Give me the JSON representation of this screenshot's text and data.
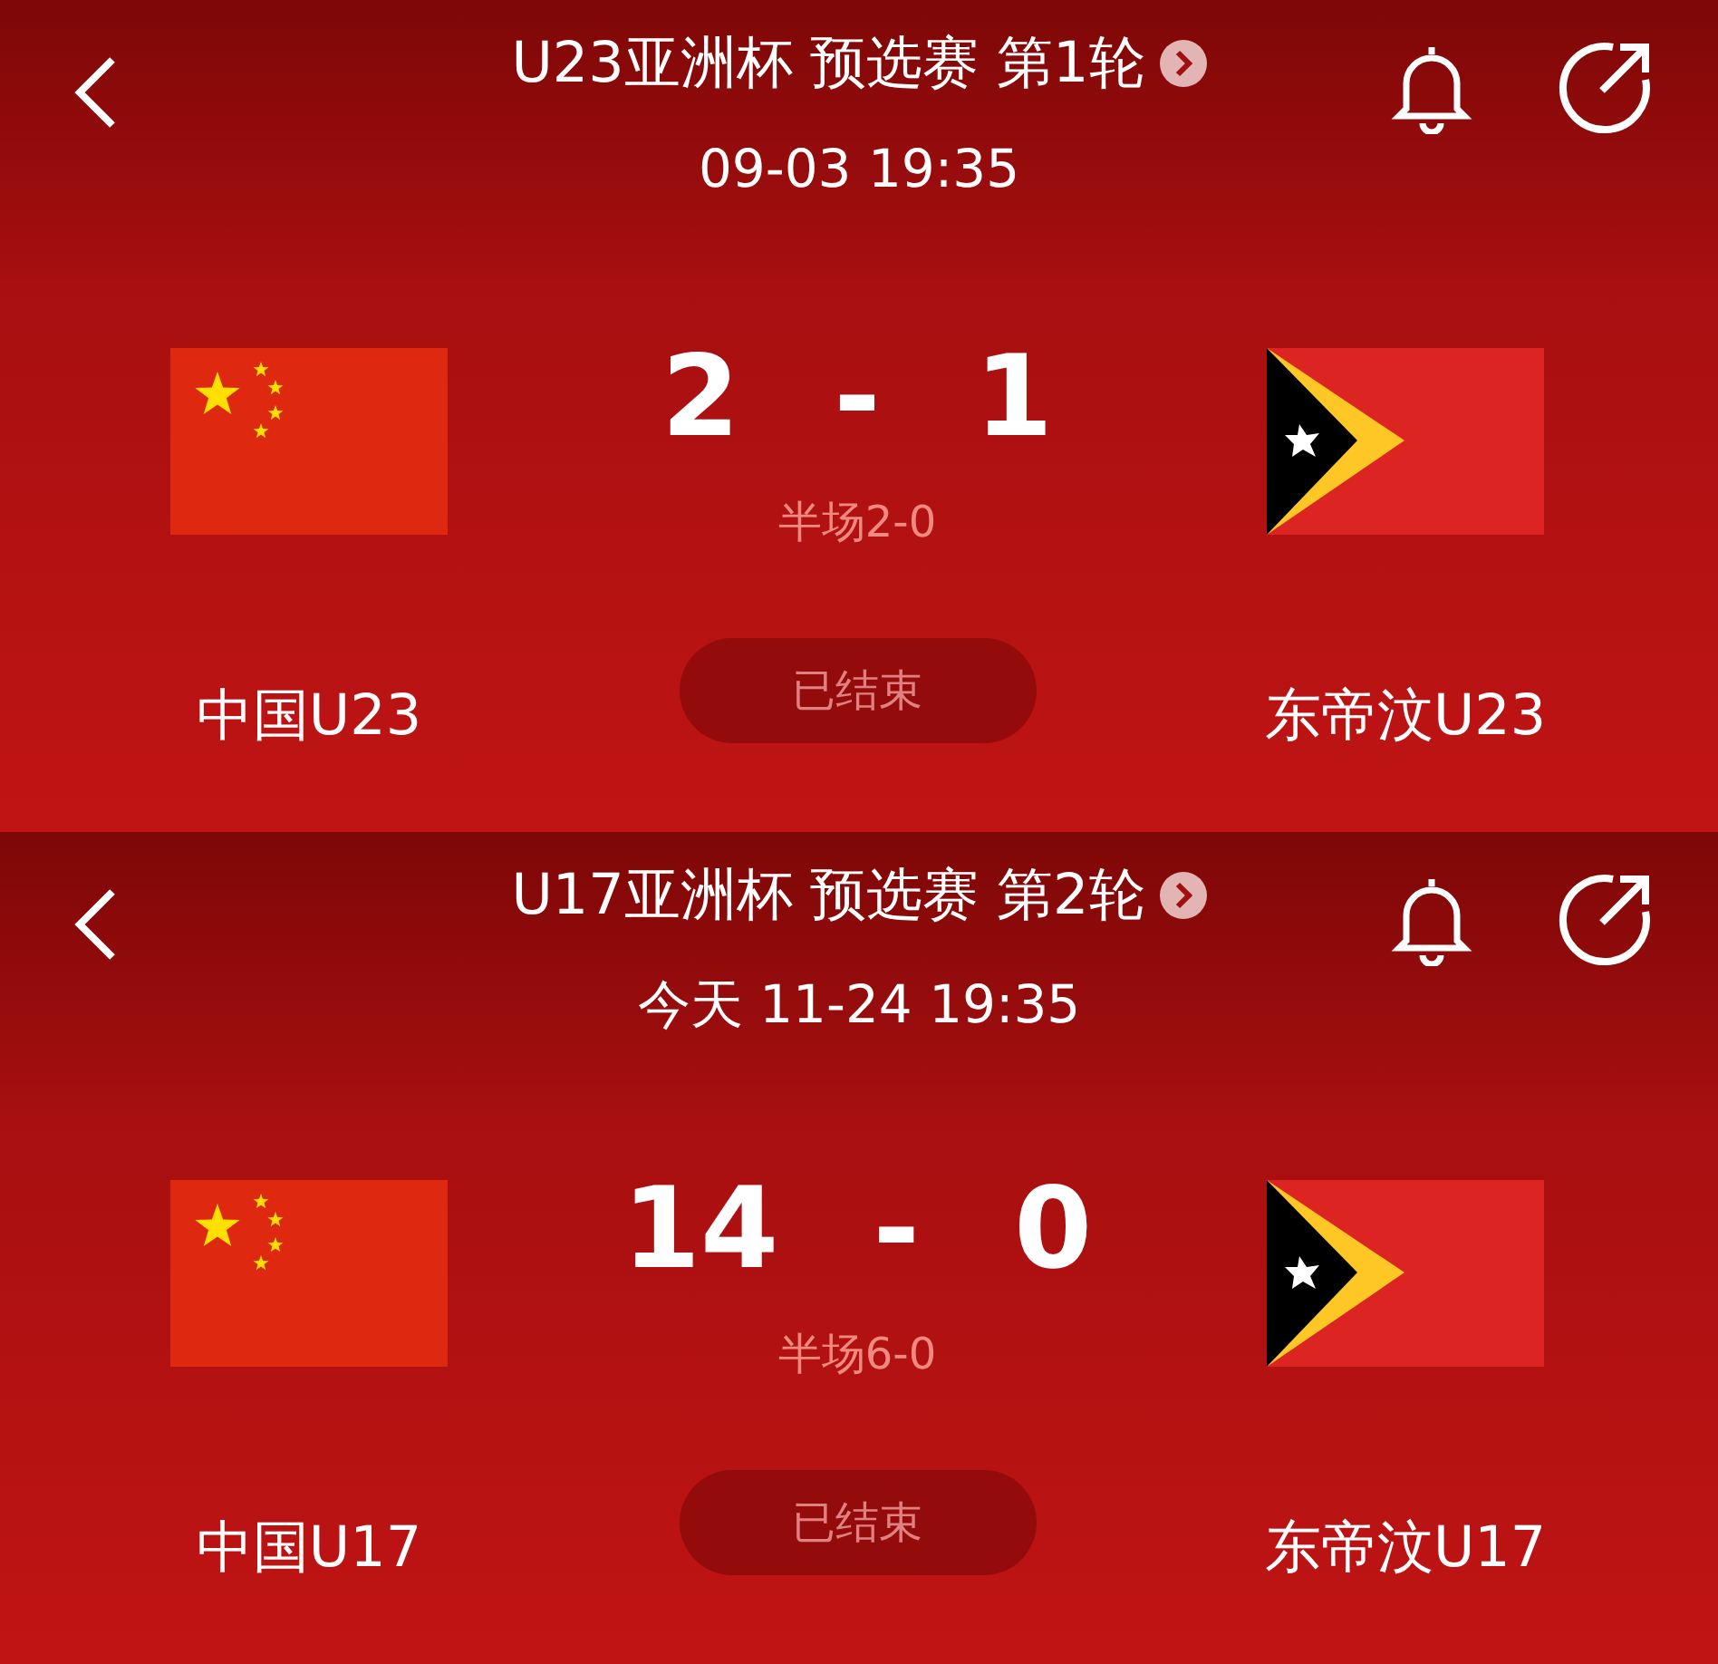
{
  "matches": [
    {
      "competition": "U23亚洲杯 预选赛 第1轮",
      "datetime": "09-03 19:35",
      "home": {
        "name": "中国U23",
        "kind": "china"
      },
      "away": {
        "name": "东帝汶U23",
        "kind": "timor"
      },
      "score_home": "2",
      "separator": "-",
      "score_away": "1",
      "half_time": "半场2-0",
      "status": "已结束"
    },
    {
      "competition": "U17亚洲杯 预选赛 第2轮",
      "datetime": "今天 11-24 19:35",
      "home": {
        "name": "中国U17",
        "kind": "china"
      },
      "away": {
        "name": "东帝汶U17",
        "kind": "timor"
      },
      "score_home": "14",
      "separator": "-",
      "score_away": "0",
      "half_time": "半场6-0",
      "status": "已结束"
    }
  ]
}
